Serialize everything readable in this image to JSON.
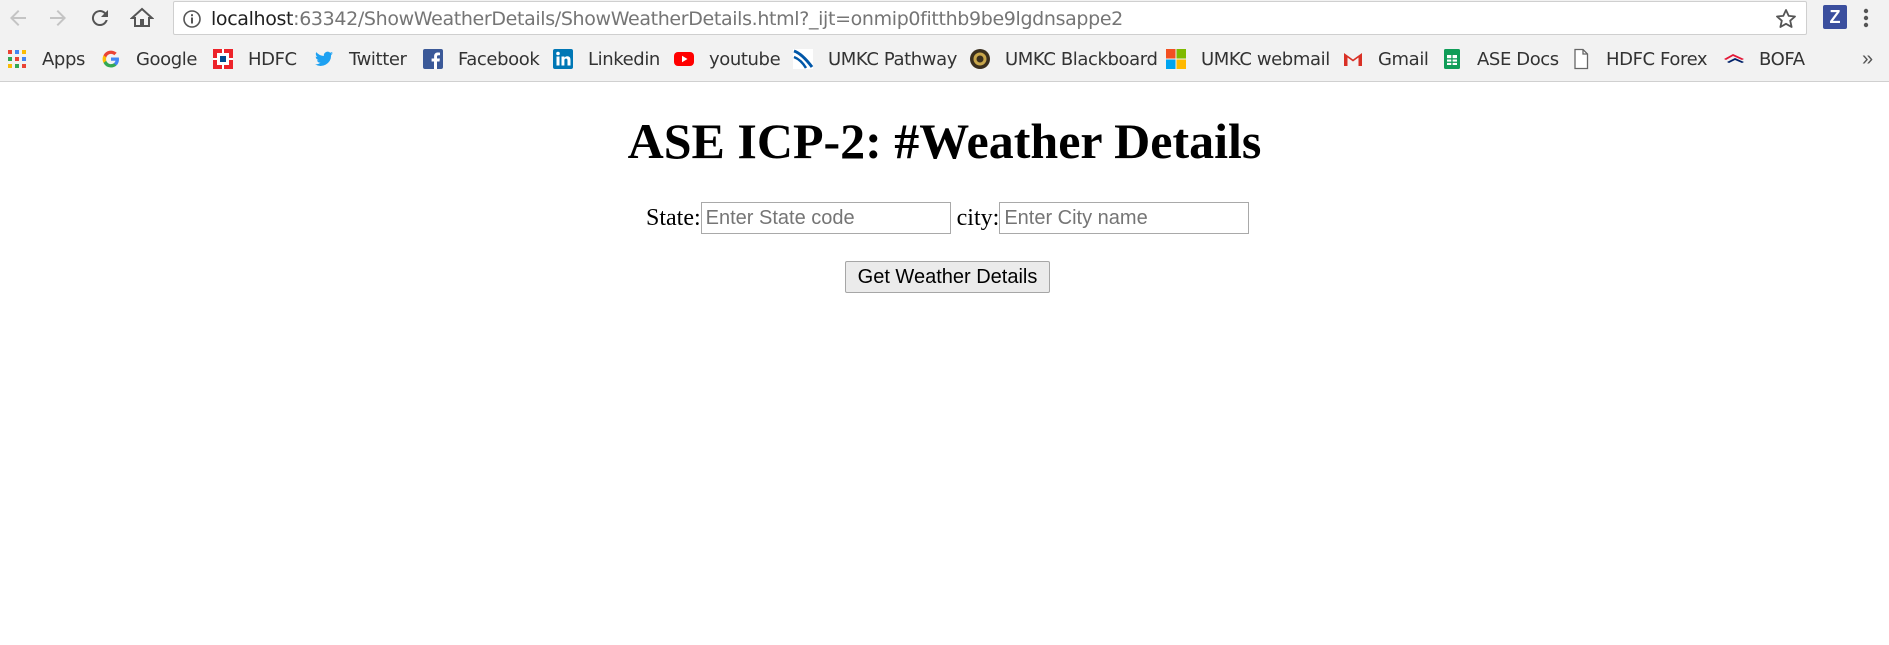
{
  "browser": {
    "url_host": "localhost",
    "url_rest": ":63342/ShowWeatherDetails/ShowWeatherDetails.html?_ijt=onmip0fitthb9be9lgdnsappe2",
    "extension_letter": "Z",
    "bookmarks": [
      {
        "label": "Apps",
        "icon": "apps-grid-icon"
      },
      {
        "label": "Google",
        "icon": "google-icon"
      },
      {
        "label": "HDFC",
        "icon": "hdfc-icon"
      },
      {
        "label": "Twitter",
        "icon": "twitter-icon"
      },
      {
        "label": "Facebook",
        "icon": "facebook-icon"
      },
      {
        "label": "Linkedin",
        "icon": "linkedin-icon"
      },
      {
        "label": "youtube",
        "icon": "youtube-icon"
      },
      {
        "label": "UMKC Pathway",
        "icon": "umkc-pathway-icon"
      },
      {
        "label": "UMKC Blackboard",
        "icon": "umkc-seal-icon"
      },
      {
        "label": "UMKC webmail",
        "icon": "microsoft-icon"
      },
      {
        "label": "Gmail",
        "icon": "gmail-icon"
      },
      {
        "label": "ASE Docs",
        "icon": "sheets-icon"
      },
      {
        "label": "HDFC Forex",
        "icon": "document-icon"
      },
      {
        "label": "BOFA",
        "icon": "bofa-icon"
      }
    ],
    "overflow_chevron": "»"
  },
  "page": {
    "title": "ASE ICP-2: #Weather Details",
    "state_label": "State:",
    "state_placeholder": "Enter State code",
    "state_value": "",
    "city_label": "city:",
    "city_placeholder": "Enter City name",
    "city_value": "",
    "button_label": "Get Weather Details"
  }
}
